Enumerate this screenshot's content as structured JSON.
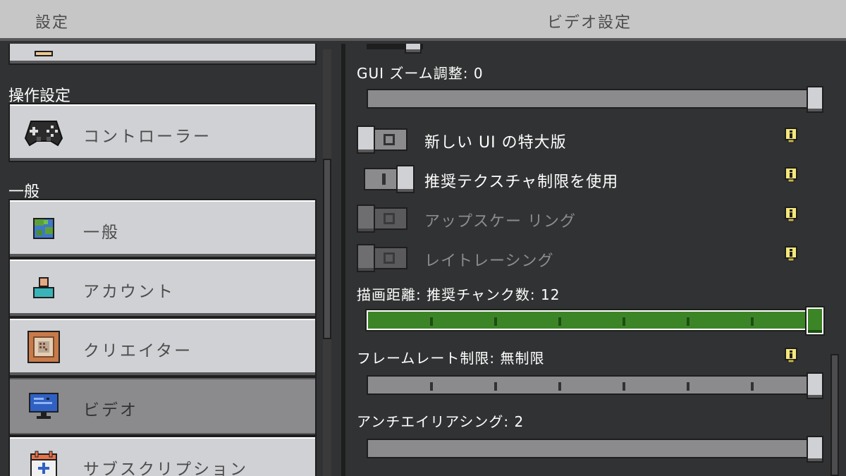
{
  "header": {
    "left_title": "設定",
    "right_title": "ビデオ設定"
  },
  "sidebar": {
    "sections": {
      "controls": "操作設定",
      "general": "一般"
    },
    "items": [
      {
        "label": "コントローラー",
        "icon": "controller-icon"
      },
      {
        "label": "一般",
        "icon": "globe-icon"
      },
      {
        "label": "アカウント",
        "icon": "account-icon"
      },
      {
        "label": "クリエイター",
        "icon": "command-block-icon"
      },
      {
        "label": "ビデオ",
        "icon": "monitor-icon",
        "selected": true
      },
      {
        "label": "サブスクリプション",
        "icon": "calendar-plus-icon"
      }
    ]
  },
  "video": {
    "gui_zoom": {
      "label": "GUI ズーム調整: 0",
      "value": 1.0
    },
    "large_ui": {
      "label": "新しい UI の特大版",
      "on": false
    },
    "texture_limit": {
      "label": "推奨テクスチャ制限を使用",
      "on": true
    },
    "upscaling": {
      "label": "アップスケー リング",
      "on": false,
      "disabled": true
    },
    "raytracing": {
      "label": "レイトレーシング",
      "on": false,
      "disabled": true
    },
    "render_distance": {
      "label": "描画距離: 推奨チャンク数: 12",
      "value": 1.0
    },
    "frame_rate": {
      "label": "フレームレート制限: 無制限",
      "value": 1.0
    },
    "antialiasing": {
      "label": "アンチエイリアシング: 2",
      "value": 1.0
    }
  },
  "colors": {
    "header_bg": "#c6c6c6",
    "panel_bg": "#313233",
    "button_bg": "#d0d1d4",
    "selected_bg": "#8b8b8d",
    "accent_green": "#3c8527",
    "info_yellow": "#f6e87a"
  }
}
